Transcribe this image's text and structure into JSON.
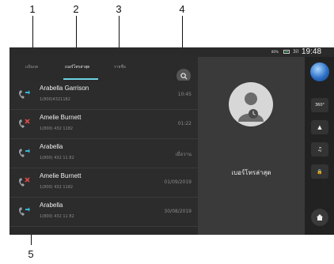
{
  "callouts": [
    "1",
    "2",
    "3",
    "4",
    "5"
  ],
  "tabs": [
    {
      "label": "แป้นกด"
    },
    {
      "label": "เบอร์โทรล่าสุด"
    },
    {
      "label": "รายชื่อ"
    }
  ],
  "status": {
    "battery": "80%",
    "signal": "3il",
    "time": "19:48"
  },
  "calls": [
    {
      "name": "Arabella Garrison",
      "number": "1(800)4321182",
      "time": "10:45",
      "type": "incoming",
      "color": "#35b8d6"
    },
    {
      "name": "Amelie Burnett",
      "number": "1(800) 432 1182",
      "time": "01:22",
      "type": "missed",
      "color": "#e04a4a"
    },
    {
      "name": "Arabella",
      "number": "1(800) 432 11 82",
      "time": "เมื่อวาน",
      "type": "incoming",
      "color": "#35b8d6"
    },
    {
      "name": "Amelie Burnett",
      "number": "1(800) 432 1182",
      "time": "01/09/2019",
      "type": "missed",
      "color": "#e04a4a"
    },
    {
      "name": "Arabella",
      "number": "1(800) 432 11 82",
      "time": "30/08/2019",
      "type": "incoming",
      "color": "#35b8d6"
    }
  ],
  "panel": {
    "title": "เบอร์โทรล่าสุด"
  },
  "sidebar": {
    "btn_360": "360°",
    "btn_nav": "▲",
    "btn_music": "♫",
    "btn_lock": "🔒"
  },
  "colors": {
    "accent": "#6fd3e3"
  }
}
